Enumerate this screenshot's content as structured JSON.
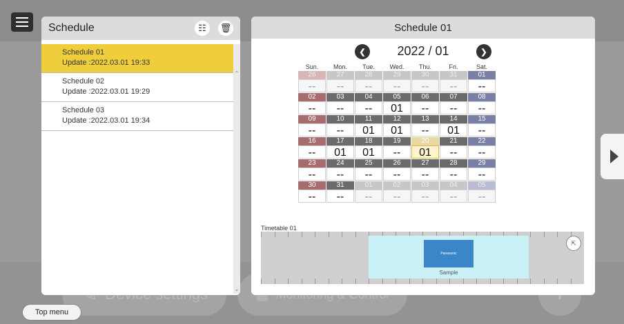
{
  "background": {
    "device_settings_label": "Device settings",
    "monitoring_label": "Monitoring & Control"
  },
  "left_panel": {
    "title": "Schedule",
    "items": [
      {
        "name": "Schedule 01",
        "update": "Update :2022.03.01  19:33",
        "selected": true
      },
      {
        "name": "Schedule 02",
        "update": "Update :2022.03.01  19:29",
        "selected": false
      },
      {
        "name": "Schedule 03",
        "update": "Update :2022.03.01  19:34",
        "selected": false
      }
    ]
  },
  "right_panel": {
    "title": "Schedule 01",
    "month_label": "2022 / 01",
    "days_of_week": [
      "Sun.",
      "Mon.",
      "Tue.",
      "Wed.",
      "Thu.",
      "Fri.",
      "Sat."
    ],
    "weeks": [
      [
        {
          "d": "26",
          "v": "--",
          "f": true
        },
        {
          "d": "27",
          "v": "--",
          "f": true
        },
        {
          "d": "28",
          "v": "--",
          "f": true
        },
        {
          "d": "29",
          "v": "--",
          "f": true
        },
        {
          "d": "30",
          "v": "--",
          "f": true
        },
        {
          "d": "31",
          "v": "--",
          "f": true
        },
        {
          "d": "01",
          "v": "--",
          "f": false
        }
      ],
      [
        {
          "d": "02",
          "v": "--",
          "f": false
        },
        {
          "d": "03",
          "v": "--",
          "f": false
        },
        {
          "d": "04",
          "v": "--",
          "f": false
        },
        {
          "d": "05",
          "v": "01",
          "f": false
        },
        {
          "d": "06",
          "v": "--",
          "f": false
        },
        {
          "d": "07",
          "v": "--",
          "f": false
        },
        {
          "d": "08",
          "v": "--",
          "f": false
        }
      ],
      [
        {
          "d": "09",
          "v": "--",
          "f": false
        },
        {
          "d": "10",
          "v": "--",
          "f": false
        },
        {
          "d": "11",
          "v": "01",
          "f": false
        },
        {
          "d": "12",
          "v": "01",
          "f": false
        },
        {
          "d": "13",
          "v": "--",
          "f": false
        },
        {
          "d": "14",
          "v": "01",
          "f": false
        },
        {
          "d": "15",
          "v": "--",
          "f": false
        }
      ],
      [
        {
          "d": "16",
          "v": "--",
          "f": false
        },
        {
          "d": "17",
          "v": "01",
          "f": false
        },
        {
          "d": "18",
          "v": "01",
          "f": false
        },
        {
          "d": "19",
          "v": "--",
          "f": false
        },
        {
          "d": "20",
          "v": "01",
          "f": false,
          "today": true
        },
        {
          "d": "21",
          "v": "--",
          "f": false
        },
        {
          "d": "22",
          "v": "--",
          "f": false
        }
      ],
      [
        {
          "d": "23",
          "v": "--",
          "f": false
        },
        {
          "d": "24",
          "v": "--",
          "f": false
        },
        {
          "d": "25",
          "v": "--",
          "f": false
        },
        {
          "d": "26",
          "v": "--",
          "f": false
        },
        {
          "d": "27",
          "v": "--",
          "f": false
        },
        {
          "d": "28",
          "v": "--",
          "f": false
        },
        {
          "d": "29",
          "v": "--",
          "f": false
        }
      ],
      [
        {
          "d": "30",
          "v": "--",
          "f": false
        },
        {
          "d": "31",
          "v": "--",
          "f": false
        },
        {
          "d": "01",
          "v": "--",
          "f": true
        },
        {
          "d": "02",
          "v": "--",
          "f": true
        },
        {
          "d": "03",
          "v": "--",
          "f": true
        },
        {
          "d": "04",
          "v": "--",
          "f": true
        },
        {
          "d": "05",
          "v": "--",
          "f": true
        }
      ]
    ],
    "timetable_label": "Timetable 01",
    "timetable_thumb_text": "Panasonic",
    "timetable_block_label": "Sample"
  },
  "top_menu_label": "Top menu",
  "colors": {
    "selected_item": "#f0ce3b",
    "today": "#fdf3cf",
    "sunday": "#a86c6e",
    "saturday": "#7a7fa8"
  }
}
